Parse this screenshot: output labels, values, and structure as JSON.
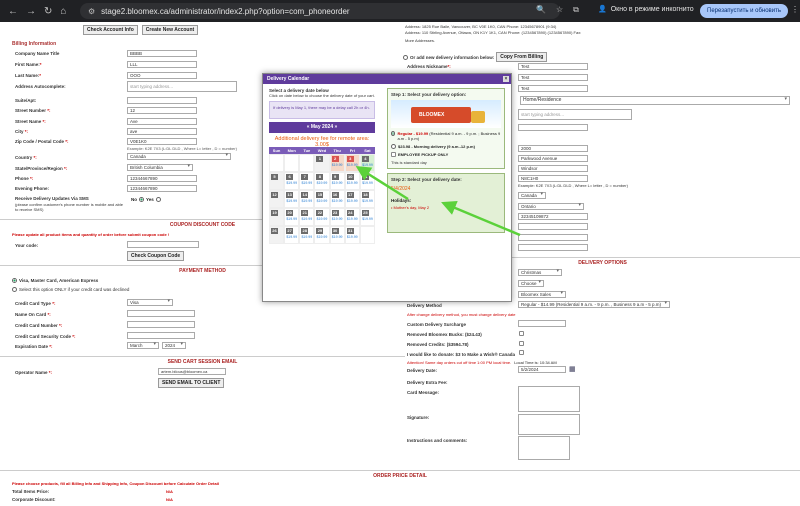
{
  "browser": {
    "url": "stage2.bloomex.ca/administrator/index2.php?option=com_phoneorder",
    "incognito_label": "Окно в режиме инкогнито",
    "relaunch_label": "Перезапустить и обновить"
  },
  "top_buttons": {
    "check_account": "Check Account Info",
    "create_account": "Create New Account"
  },
  "billing": {
    "heading": "Billing Information",
    "company_label": "Company Name Title",
    "company_value": "BBBB",
    "first_name_label": "First Name:",
    "first_name_value": "LLL",
    "last_name_label": "Last Name:",
    "last_name_value": "OOO",
    "autocomplete_label": "Address Autocomplete:",
    "autocomplete_placeholder": "start typing address...",
    "suite_label": "Suite/Apt:",
    "street_number_label": "Street Number",
    "street_number_value": "12",
    "street_name_label": "Street Name",
    "street_name_value": "Ave",
    "city_label": "City",
    "city_value": "ave",
    "zip_label": "Zip Code / Postal Code",
    "zip_value": "V0E1K0",
    "zip_note": "Example: K2E 7X3 (L:DL DLD , Where L= letter , D = number)",
    "country_label": "Country",
    "country_value": "Canada",
    "state_label": "State/Province/Region",
    "state_value": "British Columbia",
    "phone_label": "Phone",
    "phone_value": "12344667890",
    "evening_phone_label": "Evening Phone:",
    "evening_phone_value": "12344667890",
    "sms_label": "Receive Delivery Updates Via SMS",
    "sms_note": "(please confirm customer's phone number is mobile and able to receive SMS)",
    "sms_no": "No",
    "sms_yes": "Yes"
  },
  "coupon": {
    "heading": "COUPON DISCOUNT CODE",
    "note": "Please update all product items and quantity of order before submit coupon code !",
    "code_label": "Your code:",
    "check_button": "Check Coupon Code"
  },
  "payment": {
    "heading": "PAYMENT METHOD",
    "option1": "Visa, Master Card, American Express",
    "option2": "Select this option ONLY if your credit card was declined",
    "card_type_label": "Credit Card Type",
    "card_type_value": "Visa",
    "name_label": "Name On Card",
    "number_label": "Credit Card Number",
    "security_label": "Credit Card Security Code",
    "expiration_label": "Expiration Date",
    "exp_month": "March",
    "exp_year": "2024"
  },
  "session_email": {
    "heading": "SEND CART SESSION EMAIL",
    "operator_label": "Operator Name",
    "operator_value": "artem.bilous@bloomex.ca",
    "send_button": "SEND EMAIL TO CLIENT"
  },
  "shipping_right": {
    "addr1": "Address: 1825 Rue Baile, Vancouver, BC V0E 1K0, CAN Phone: 12345678901 (9:34)",
    "addr2": "Address: 110 Stirling Avenue, Ottawa, ON K1Y 1K1, CAN Phone: (1234567890) (1234567890) Fax:",
    "more_addresses": "More Addresses.",
    "add_new": "Or add new delivery information below:",
    "copy_button": "Copy From Billing",
    "nickname_label": "Address Nickname",
    "nickname_value": "Test",
    "first_name_label": "First Name",
    "first_name_value": "Test",
    "last_name_label": "Last Name",
    "last_name_value": "Test",
    "address_type": "Home/Residence",
    "autocomplete_placeholder": "start typing address...",
    "number_value": "2000",
    "street_value": "Parkwood Avenue",
    "city_value": "Windsor",
    "zip_value": "N8C1H0",
    "zip_note": "Example: K2E 7X3 (L:DL DLD , Where L= letter , D = number)",
    "country_value": "Canada",
    "state_value": "Ontario",
    "phone_value": "32345109872"
  },
  "delivery_options": {
    "heading": "DELIVERY OPTIONS",
    "occasion": "Christmas",
    "choose": "Choose",
    "sender": "Bloomex Sales",
    "method_label": "Delivery Method",
    "method_value": "Regular - $14.99 (Residential 9 a.m. - 9 p.m. , Business 9 a.m - 5 p.m)",
    "change_note": "After change delivery method, you must change delivery date",
    "surcharge_label": "Custom Delivery Surcharge",
    "remove_bucks_label": "Removed Bloomex Bucks: ($24.43)",
    "remove_credits_label": "Removed Credits: ($3594.78)",
    "donate_label": "I would like to donate: $3 to Make a Wish® Canada",
    "attention": "Attention! Same day orders cut off time 1:00 PM local time.",
    "local_time": "Local Time is: 10:34 AM",
    "date_label": "Delivery Date:",
    "date_value": "5/2/2024",
    "extra_fee_label": "Delivery Extra Fee:",
    "card_message_label": "Card Message:",
    "signature_label": "Signature:",
    "instructions_label": "Instructions and comments:"
  },
  "order_detail": {
    "heading": "ORDER PRICE DETAIL",
    "note": "Please choose products, fill all Billing Info and Shipping Info, Coupon Discount before Calculate Order Detail",
    "total_price_label": "Total Items Price:",
    "total_price_value": "N/A",
    "corporate_label": "Corporate Discount:",
    "corporate_value": "N/A"
  },
  "modal": {
    "title": "Delivery Calendar",
    "instruction_bold": "Select a delivery date below",
    "instruction_line": "Click on date below to choose the delivery date of your cart.",
    "warning": "If delivery is May 1, there may be a delay call 2h or 4h.",
    "month_label": "« May 2024 »",
    "additional_fee": "Additional delivery fee for remote area: 3.00$",
    "weekdays": [
      "Sun",
      "Mon",
      "Tue",
      "Wed",
      "Thu",
      "Fri",
      "Sat"
    ],
    "step1_title": "Step 1: Select your delivery option:",
    "truck_label": "BLOOMEX",
    "option_regular_price": "Regular - $19.99",
    "option_regular_text": "(Residential 9 a.m. - 9 p.m. ; Business 9 a.m - 5 p.m)",
    "option_morning_price": "$23.98 - Morning delivery",
    "option_morning_text": "(9 a.m.-12 p.m)",
    "option_pickup": "EMPLOYEE PICKUP ONLY",
    "standard_day": "This is standard day",
    "step2_title": "Step 2: Select your delivery date:",
    "selected_date": "5/4/2024",
    "holidays_label": "Holidays:",
    "holiday_item": "• Mother's day, May 2"
  },
  "calendar_days": [
    {
      "n": "",
      "p": "",
      "s": "empty"
    },
    {
      "n": "",
      "p": "",
      "s": "empty"
    },
    {
      "n": "",
      "p": "",
      "s": "empty"
    },
    {
      "n": "1",
      "p": "",
      "s": "dis"
    },
    {
      "n": "2",
      "p": "$19.99",
      "s": "hl"
    },
    {
      "n": "3",
      "p": "$19.99",
      "s": "hl"
    },
    {
      "n": "4",
      "p": "$19.99",
      "s": "gn"
    },
    {
      "n": "5",
      "p": "",
      "s": "dis"
    },
    {
      "n": "6",
      "p": "$19.99",
      "s": "n"
    },
    {
      "n": "7",
      "p": "$19.99",
      "s": "n"
    },
    {
      "n": "8",
      "p": "$19.99",
      "s": "n"
    },
    {
      "n": "9",
      "p": "$19.99",
      "s": "n"
    },
    {
      "n": "10",
      "p": "$19.99",
      "s": "n"
    },
    {
      "n": "11",
      "p": "$19.99",
      "s": "n"
    },
    {
      "n": "12",
      "p": "",
      "s": "dis"
    },
    {
      "n": "13",
      "p": "$19.99",
      "s": "n"
    },
    {
      "n": "14",
      "p": "$19.99",
      "s": "n"
    },
    {
      "n": "15",
      "p": "$19.99",
      "s": "n"
    },
    {
      "n": "16",
      "p": "$19.99",
      "s": "n"
    },
    {
      "n": "17",
      "p": "$19.99",
      "s": "n"
    },
    {
      "n": "18",
      "p": "$19.99",
      "s": "n"
    },
    {
      "n": "19",
      "p": "",
      "s": "dis"
    },
    {
      "n": "20",
      "p": "$19.99",
      "s": "n"
    },
    {
      "n": "21",
      "p": "$19.99",
      "s": "n"
    },
    {
      "n": "22",
      "p": "$19.99",
      "s": "n"
    },
    {
      "n": "23",
      "p": "$19.99",
      "s": "n"
    },
    {
      "n": "24",
      "p": "$19.99",
      "s": "n"
    },
    {
      "n": "25",
      "p": "$19.99",
      "s": "n"
    },
    {
      "n": "26",
      "p": "",
      "s": "dis"
    },
    {
      "n": "27",
      "p": "$19.99",
      "s": "n"
    },
    {
      "n": "28",
      "p": "$19.99",
      "s": "n"
    },
    {
      "n": "29",
      "p": "$19.99",
      "s": "n"
    },
    {
      "n": "30",
      "p": "$19.99",
      "s": "n"
    },
    {
      "n": "31",
      "p": "$19.99",
      "s": "n"
    },
    {
      "n": "",
      "p": "",
      "s": "empty"
    }
  ],
  "colors": {
    "accent": "#5f3b9c",
    "arrow": "#5bd13a",
    "label_red": "#cc0000",
    "fee_orange": "#e8590c"
  }
}
